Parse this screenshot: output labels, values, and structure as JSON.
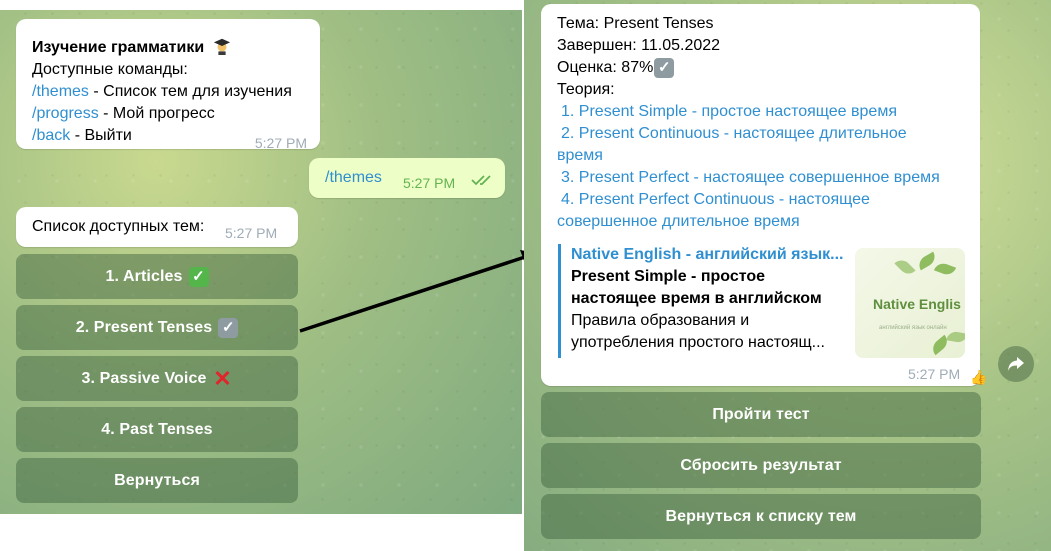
{
  "left_chat": {
    "intro": {
      "title": "Изучение грамматики",
      "title_icon": "graduate-emoji",
      "commands_header": "Доступные команды:",
      "commands": [
        {
          "cmd": "/themes",
          "desc": " - Список тем для изучения"
        },
        {
          "cmd": "/progress",
          "desc": " - Мой прогресс"
        },
        {
          "cmd": "/back",
          "desc": " - Выйти"
        }
      ],
      "time": "5:27 PM"
    },
    "outgoing": {
      "text": "/themes",
      "time": "5:27 PM"
    },
    "themes_msg": {
      "text": "Список доступных тем:",
      "time": "5:27 PM"
    },
    "buttons": [
      {
        "label": "1. Articles",
        "status": "done",
        "status_icon": "green-check-emoji"
      },
      {
        "label": "2. Present Tenses",
        "status": "partial",
        "status_icon": "gray-check-emoji"
      },
      {
        "label": "3. Passive Voice",
        "status": "failed",
        "status_icon": "red-cross-emoji"
      },
      {
        "label": "4. Past Tenses",
        "status": "none"
      },
      {
        "label": "Вернуться"
      }
    ]
  },
  "right_chat": {
    "topic_line": "Тема: Present Tenses",
    "completed_line": "Завершен: 11.05.2022",
    "score_line": "Оценка: 87%",
    "theory_header": "Теория:",
    "theory_links": [
      "1. Present Simple - простое настоящее время",
      "2. Present Continuous - настоящее длительное время",
      "3. Present Perfect - настоящее совершенное время",
      "4. Present Perfect Continuous - настоящее совершенное длительное время"
    ],
    "preview": {
      "site": "Native English - английский язык...",
      "title": "Present Simple - простое настоящее время в английском",
      "desc": "Правила образования и употребления простого настоящ...",
      "thumb_brand": "Native Englis",
      "thumb_sub": "английский язык онлайн"
    },
    "time": "5:27 PM",
    "reaction": "👍",
    "buttons": [
      "Пройти тест",
      "Сбросить результат",
      "Вернуться к списку тем"
    ]
  },
  "colors": {
    "link": "#2f8fd0",
    "keyboard_button": "#5e805e",
    "outgoing_bubble": "#eefec7"
  }
}
